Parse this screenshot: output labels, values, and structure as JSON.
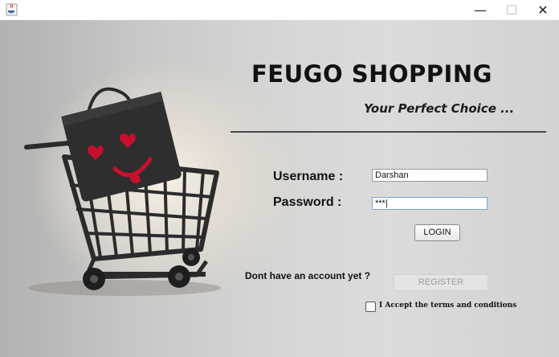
{
  "window": {
    "minimize_glyph": "—",
    "maximize_glyph": "☐",
    "close_glyph": "✕"
  },
  "header": {
    "title": "FEUGO SHOPPING",
    "tagline": "Your Perfect Choice ..."
  },
  "form": {
    "username_label": "Username :",
    "username_value": "Darshan",
    "password_label": "Password  :",
    "password_value": "***|",
    "login_label": "LOGIN"
  },
  "register": {
    "prompt": "Dont have an account yet ?",
    "button_label": "REGISTER",
    "terms_label": "I Accept the terms and conditions",
    "terms_checked": false
  },
  "colors": {
    "bag": "#2a2a2a",
    "heart": "#c8102e",
    "cart": "#2b2b2b",
    "focus_border": "#7aa6d8"
  }
}
